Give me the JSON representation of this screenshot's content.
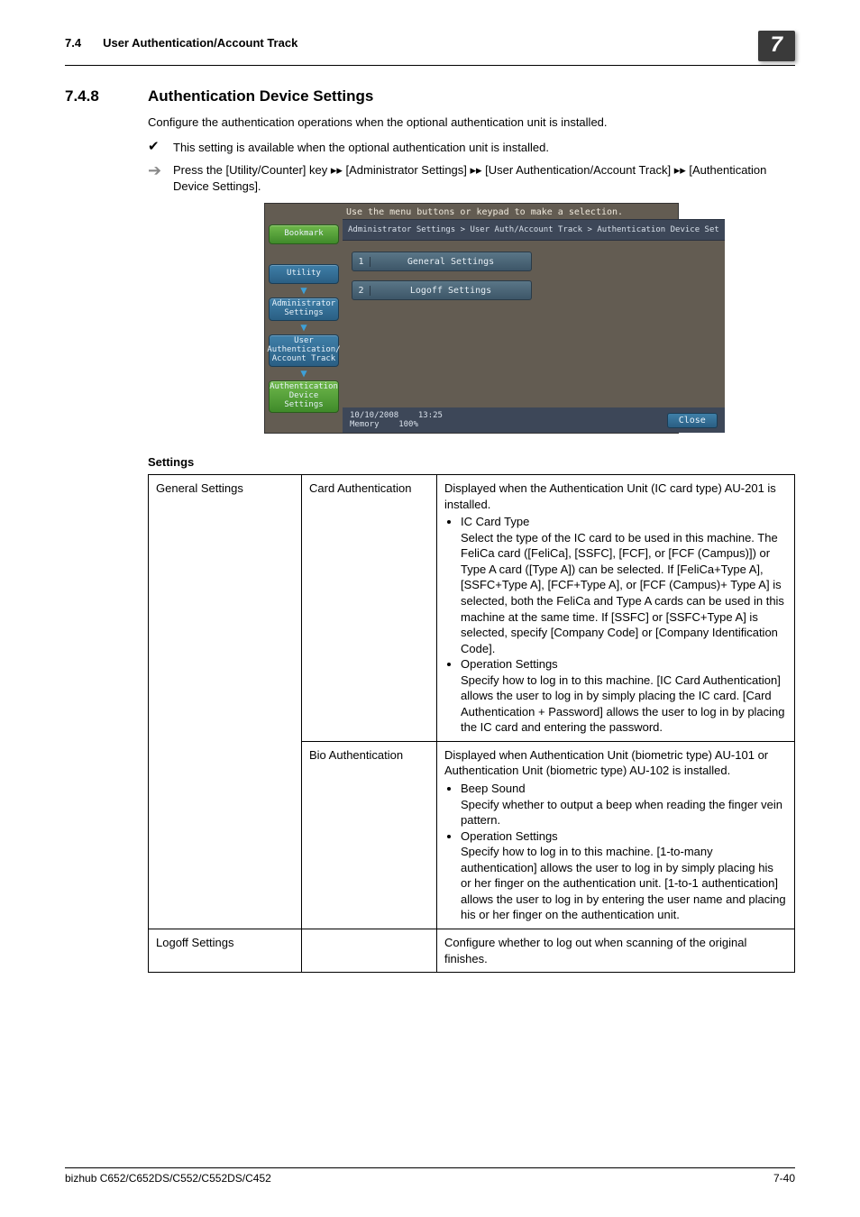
{
  "runningHead": {
    "num": "7.4",
    "title": "User Authentication/Account Track",
    "chapter": "7"
  },
  "heading": {
    "num": "7.4.8",
    "title": "Authentication Device Settings"
  },
  "intro": "Configure the authentication operations when the optional authentication unit is installed.",
  "note": "This setting is available when the optional authentication unit is installed.",
  "procedure": "Press the [Utility/Counter] key ▸▸ [Administrator Settings] ▸▸ [User Authentication/Account Track] ▸▸ [Authentication Device Settings].",
  "panel": {
    "top": "Use the menu buttons or keypad to make a selection.",
    "bookmark": "Bookmark",
    "crumb": "Administrator Settings > User Auth/Account Track > Authentication Device Set",
    "breadcrumbButtons": [
      "Utility",
      "Administrator Settings",
      "User Authentication/ Account Track",
      "Authentication Device Settings"
    ],
    "items": [
      {
        "n": "1",
        "label": "General Settings"
      },
      {
        "n": "2",
        "label": "Logoff Settings"
      }
    ],
    "date": "10/10/2008",
    "time": "13:25",
    "memLabel": "Memory",
    "mem": "100%",
    "close": "Close"
  },
  "tableCaption": "Settings",
  "rows": {
    "r1c1": "General Settings",
    "r1c2": "Card Authentication",
    "r1c3_p": "Displayed when the Authentication Unit (IC card type) AU-201 is installed.",
    "r1c3_b1t": "IC Card Type",
    "r1c3_b1d": "Select the type of the IC card to be used in this machine. The FeliCa card ([FeliCa], [SSFC], [FCF], or [FCF (Campus)]) or Type A card ([Type A]) can be selected. If [FeliCa+Type A], [SSFC+Type A], [FCF+Type A], or  [FCF (Campus)+ Type A] is selected, both the FeliCa and Type A cards can be used in this machine at the same time. If [SSFC] or [SSFC+Type A] is selected, specify [Company Code] or [Company Identification Code].",
    "r1c3_b2t": "Operation Settings",
    "r1c3_b2d": "Specify how to log in to this machine. [IC Card Authentication] allows the user to log in by simply placing the IC card. [Card Authentication + Password] allows the user to log in by placing the IC card and entering the password.",
    "r2c2": "Bio Authentication",
    "r2c3_p": "Displayed when Authentication Unit (biometric type) AU-101 or Authentication Unit (biometric type) AU-102 is installed.",
    "r2c3_b1t": "Beep Sound",
    "r2c3_b1d": "Specify whether to output a beep when reading the finger vein pattern.",
    "r2c3_b2t": "Operation Settings",
    "r2c3_b2d": "Specify how to log in to this machine. [1-to-many authentication] allows the user to log in by simply placing his or her finger on the authentication unit. [1-to-1 authentication] allows the user to log in by entering the user name and placing his or her finger on the authentication unit.",
    "r3c1": "Logoff Settings",
    "r3c3": "Configure whether to log out when scanning of the original finishes."
  },
  "footer": {
    "left": "bizhub C652/C652DS/C552/C552DS/C452",
    "right": "7-40"
  }
}
